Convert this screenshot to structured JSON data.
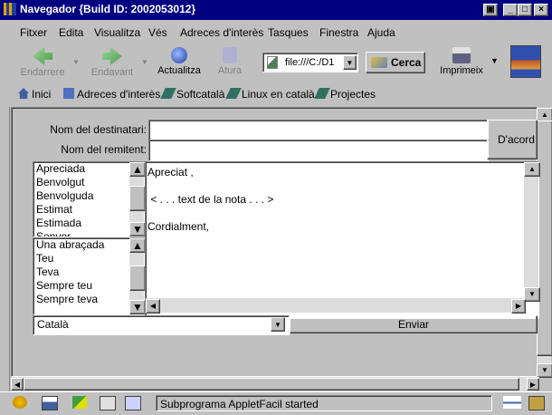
{
  "window": {
    "title": "Navegador {Build ID: 2002053012}"
  },
  "menu": [
    "Fitxer",
    "Edita",
    "Visualitza",
    "Vés",
    "Adreces d'interès",
    "Tasques",
    "Finestra",
    "Ajuda"
  ],
  "toolbar": {
    "back": "Endarrere",
    "forward": "Endavant",
    "reload": "Actualitza",
    "stop": "Atura",
    "url": "file:///C:/D1",
    "search": "Cerca",
    "print": "Imprimeix"
  },
  "personal_toolbar": [
    "Inici",
    "Adreces d'interès",
    "Softcatalà",
    "Linux en català",
    "Projectes"
  ],
  "applet": {
    "recipient_label": "Nom del destinatari:",
    "sender_label": "Nom del remitent:",
    "recipient_value": "",
    "sender_value": "",
    "ok_button": "D'acord",
    "greetings": [
      "Apreciada",
      "Benvolgut",
      "Benvolguda",
      "Estimat",
      "Estimada",
      "Senyor"
    ],
    "closings": [
      "Una abraçada",
      "Teu",
      "Teva",
      "Sempre teu",
      "Sempre teva"
    ],
    "note_lines": [
      "Apreciat ,",
      "",
      " < . . . text de la nota . . . >",
      "",
      "Cordialment,"
    ],
    "language": "Català",
    "send_button": "Enviar"
  },
  "status": {
    "text": "Subprograma AppletFacil started"
  },
  "colors": {
    "titlebar": "#000080",
    "face": "#c0c0c0"
  }
}
